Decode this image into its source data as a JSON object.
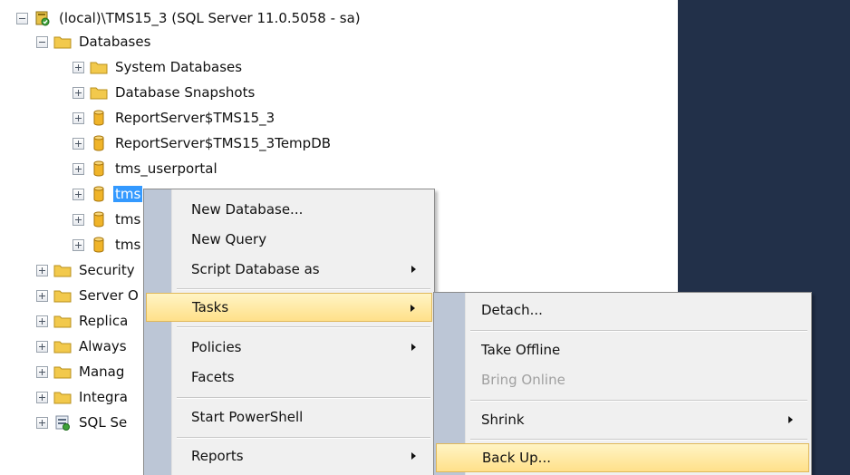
{
  "tree": {
    "server": "(local)\\TMS15_3 (SQL Server 11.0.5058 - sa)",
    "databases": "Databases",
    "db_items": [
      "System Databases",
      "Database Snapshots",
      "ReportServer$TMS15_3",
      "ReportServer$TMS15_3TempDB",
      "tms_userportal",
      "tms",
      "tms",
      "tms"
    ],
    "server_items": [
      "Security",
      "Server O",
      "Replica",
      "Always",
      "Manag",
      "Integra",
      "SQL Se"
    ]
  },
  "context_menu": {
    "items": [
      "New Database...",
      "New Query",
      "Script Database as",
      "Tasks",
      "Policies",
      "Facets",
      "Start PowerShell",
      "Reports"
    ]
  },
  "tasks_menu": {
    "items": [
      "Detach...",
      "Take Offline",
      "Bring Online",
      "Shrink",
      "Back Up..."
    ]
  },
  "colors": {
    "right_pane": "#223049",
    "menu_bg": "#f0f0f0",
    "menu_gutter": "#bcc6d6",
    "highlight": "#ffe08a",
    "selection": "#3399ff",
    "folder": "#f2c94c",
    "database": "#f0b429"
  },
  "icons": {
    "server": "server-icon",
    "folder": "folder-icon",
    "database": "database-icon",
    "sql_agent": "sql-agent-icon"
  }
}
